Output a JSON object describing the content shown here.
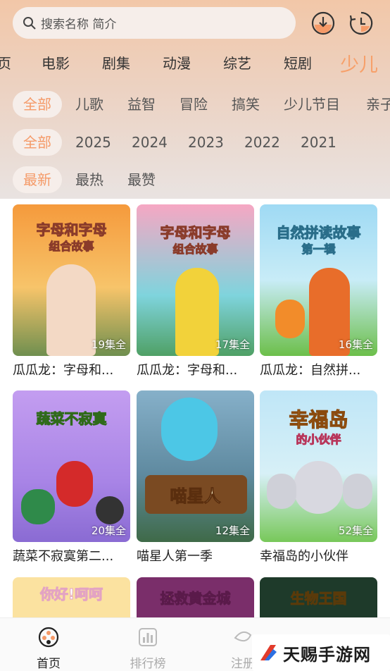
{
  "search": {
    "placeholder": "搜索名称 简介"
  },
  "channels": [
    {
      "label": "页"
    },
    {
      "label": "电影"
    },
    {
      "label": "剧集"
    },
    {
      "label": "动漫"
    },
    {
      "label": "综艺"
    },
    {
      "label": "短剧"
    },
    {
      "label": "少儿"
    }
  ],
  "active_channel": "少儿",
  "genre_filters": [
    {
      "label": "全部"
    },
    {
      "label": "儿歌"
    },
    {
      "label": "益智"
    },
    {
      "label": "冒险"
    },
    {
      "label": "搞笑"
    },
    {
      "label": "少儿节目"
    },
    {
      "label": "亲子"
    }
  ],
  "year_filters": [
    {
      "label": "全部"
    },
    {
      "label": "2025"
    },
    {
      "label": "2024"
    },
    {
      "label": "2023"
    },
    {
      "label": "2022"
    },
    {
      "label": "2021"
    }
  ],
  "sort_filters": [
    {
      "label": "最新"
    },
    {
      "label": "最热"
    },
    {
      "label": "最赞"
    }
  ],
  "items": [
    {
      "title": "瓜瓜龙：字母和...",
      "badge": "19集全",
      "poster_text": "字母和字母",
      "poster_sub": "组合故事"
    },
    {
      "title": "瓜瓜龙：字母和...",
      "badge": "17集全",
      "poster_text": "字母和字母",
      "poster_sub": "组合故事"
    },
    {
      "title": "瓜瓜龙：自然拼...",
      "badge": "16集全",
      "poster_text": "自然拼读故事",
      "poster_sub": "第一辑"
    },
    {
      "title": "蔬菜不寂寞第二...",
      "badge": "20集全",
      "poster_text": "蔬菜不寂寞",
      "poster_sub": ""
    },
    {
      "title": "喵星人第一季",
      "badge": "12集全",
      "poster_text": "喵星人",
      "poster_sub": ""
    },
    {
      "title": "幸福岛的小伙伴",
      "badge": "52集全",
      "poster_text": "幸福岛",
      "poster_sub": "的小伙伴"
    },
    {
      "title": "",
      "badge": "",
      "poster_text": "你好!呵呵",
      "poster_sub": ""
    },
    {
      "title": "",
      "badge": "",
      "poster_text": "拯救黄金城",
      "poster_sub": ""
    },
    {
      "title": "",
      "badge": "",
      "poster_text": "生物王国",
      "poster_sub": ""
    }
  ],
  "bottom_tabs": [
    {
      "label": "首页"
    },
    {
      "label": "排行榜"
    },
    {
      "label": "注册"
    }
  ],
  "watermark": {
    "text": "天赐手游网"
  },
  "colors": {
    "accent": "#f59a68",
    "chip_bg": "#f6eeea"
  }
}
